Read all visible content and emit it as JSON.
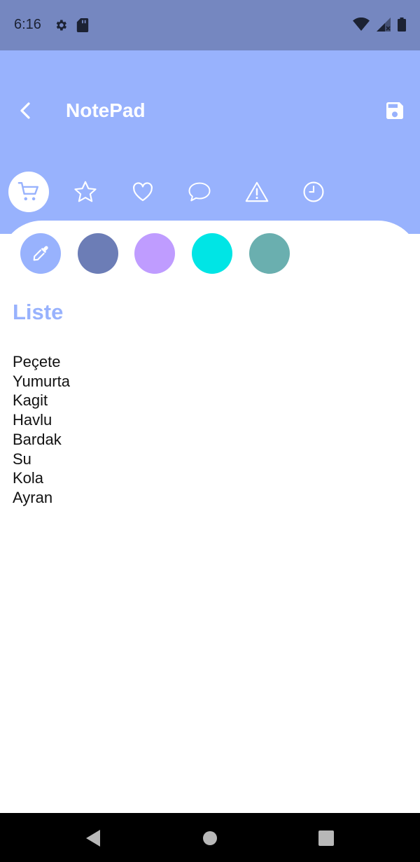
{
  "status_bar": {
    "time": "6:16",
    "left_icons": [
      "gear-icon",
      "sd-card-icon"
    ],
    "right_icons": [
      "wifi-icon",
      "signal-icon",
      "battery-icon"
    ]
  },
  "app_bar": {
    "title": "NotePad",
    "background": "#98b2fd",
    "back_icon": "chevron-left-icon",
    "save_icon": "floppy-disk-icon"
  },
  "categories": [
    {
      "icon": "shopping-cart-icon",
      "selected": true
    },
    {
      "icon": "star-icon",
      "selected": false
    },
    {
      "icon": "heart-icon",
      "selected": false
    },
    {
      "icon": "chat-bubble-icon",
      "selected": false
    },
    {
      "icon": "warning-icon",
      "selected": false
    },
    {
      "icon": "clock-icon",
      "selected": false
    }
  ],
  "colors": {
    "picker_icon": "eyedropper-icon",
    "picker_color": "#98b2fd",
    "swatches": [
      "#6c7db6",
      "#bf9cff",
      "#00e5e5",
      "#6aafaf"
    ]
  },
  "note": {
    "title": "Liste",
    "lines": [
      "Peçete",
      "Yumurta",
      "Kagit",
      "Havlu",
      "Bardak",
      "Su",
      "Kola",
      "Ayran"
    ]
  },
  "nav_bar": {
    "buttons": [
      "back-triangle-icon",
      "home-circle-icon",
      "recents-square-icon"
    ]
  }
}
